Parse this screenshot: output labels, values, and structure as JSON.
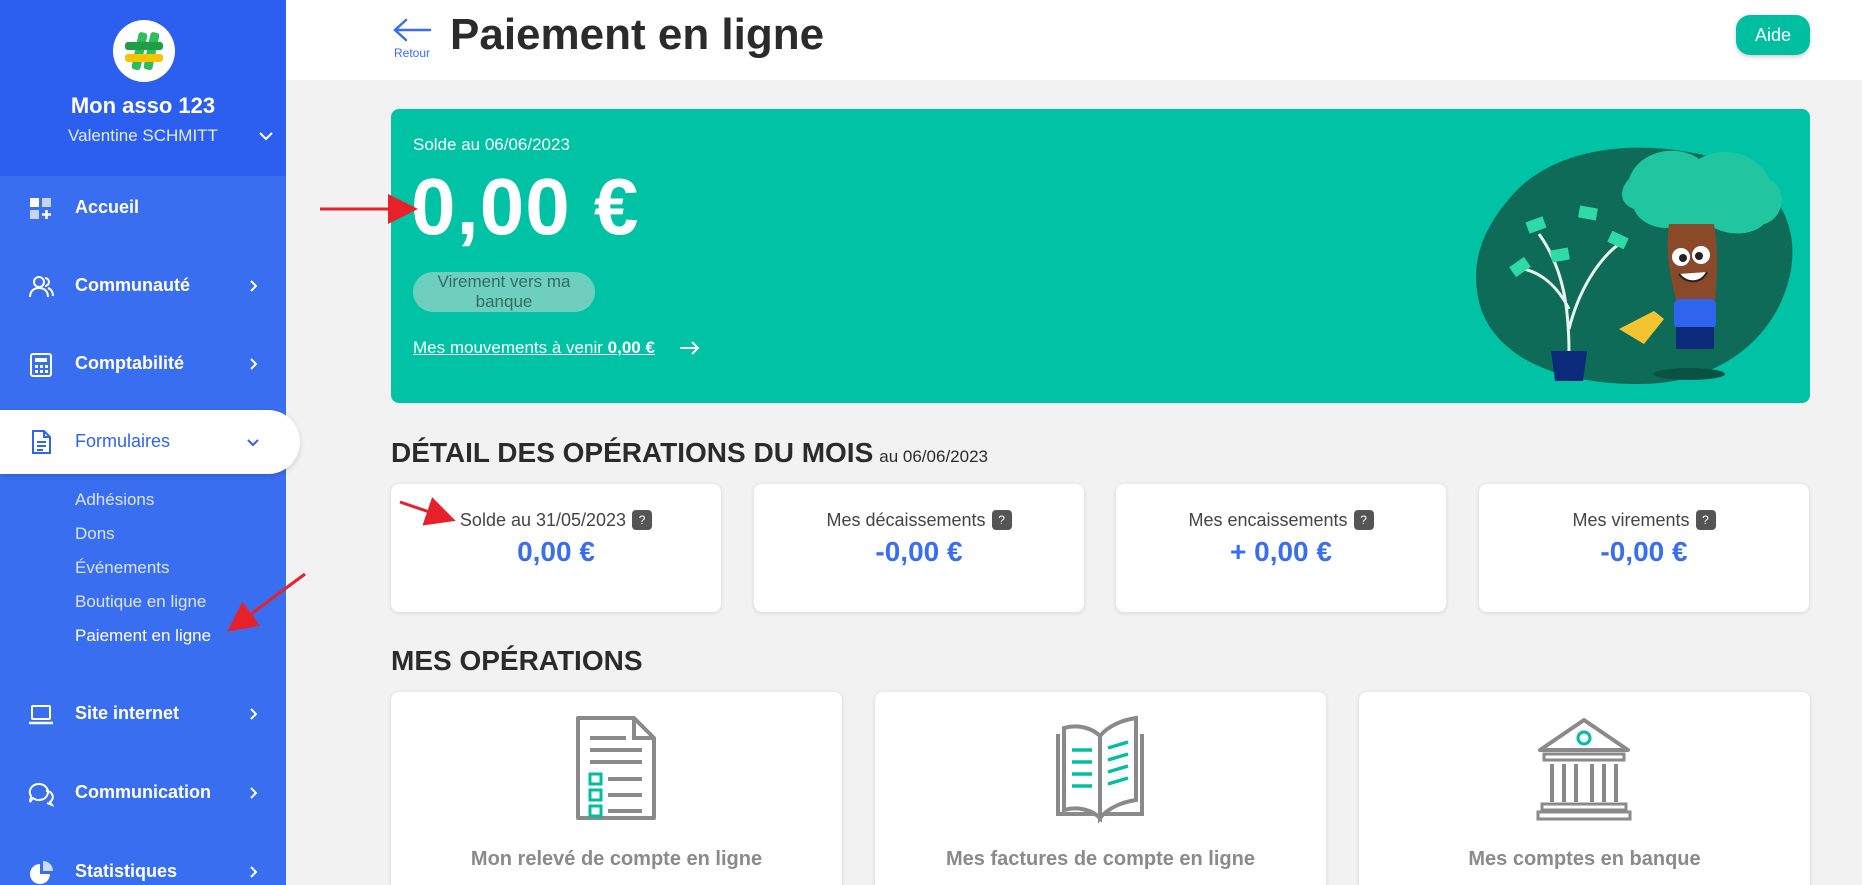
{
  "sidebar": {
    "org_name": "Mon asso 123",
    "user_name": "Valentine SCHMITT",
    "nav": [
      {
        "label": "Accueil",
        "icon": "dashboard-icon"
      },
      {
        "label": "Communauté",
        "icon": "community-icon"
      },
      {
        "label": "Comptabilité",
        "icon": "calculator-icon"
      },
      {
        "label": "Formulaires",
        "icon": "document-icon",
        "active": true
      },
      {
        "label": "Site internet",
        "icon": "laptop-icon"
      },
      {
        "label": "Communication",
        "icon": "chat-icon"
      },
      {
        "label": "Statistiques",
        "icon": "pie-chart-icon"
      }
    ],
    "sub_items": [
      "Adhésions",
      "Dons",
      "Événements",
      "Boutique en ligne",
      "Paiement en ligne"
    ]
  },
  "header": {
    "back_label": "Retour",
    "title": "Paiement en ligne",
    "help_label": "Aide"
  },
  "balance": {
    "date_label": "Solde au 06/06/2023",
    "amount": "0,00 €",
    "transfer_label": "Virement vers ma banque",
    "upcoming_label": "Mes mouvements à venir",
    "upcoming_amount": "0,00 €"
  },
  "month_details": {
    "title": "DÉTAIL DES OPÉRATIONS DU MOIS",
    "subtitle": "au 06/06/2023",
    "cards": [
      {
        "label": "Solde au 31/05/2023",
        "value": "0,00 €"
      },
      {
        "label": "Mes décaissements",
        "value": "-0,00 €"
      },
      {
        "label": "Mes encaissements",
        "value": "+ 0,00 €"
      },
      {
        "label": "Mes virements",
        "value": "-0,00 €"
      }
    ],
    "help_glyph": "?"
  },
  "operations": {
    "title": "MES OPÉRATIONS",
    "cards": [
      {
        "label": "Mon relevé de compte en ligne",
        "icon": "statement-icon"
      },
      {
        "label": "Mes factures de compte en ligne",
        "icon": "open-book-icon"
      },
      {
        "label": "Mes comptes en banque",
        "icon": "bank-icon"
      }
    ]
  },
  "colors": {
    "sidebar": "#3a6ef0",
    "accent": "#00c2a4",
    "value_blue": "#3a6ef0",
    "annotation": "#e8202a"
  }
}
